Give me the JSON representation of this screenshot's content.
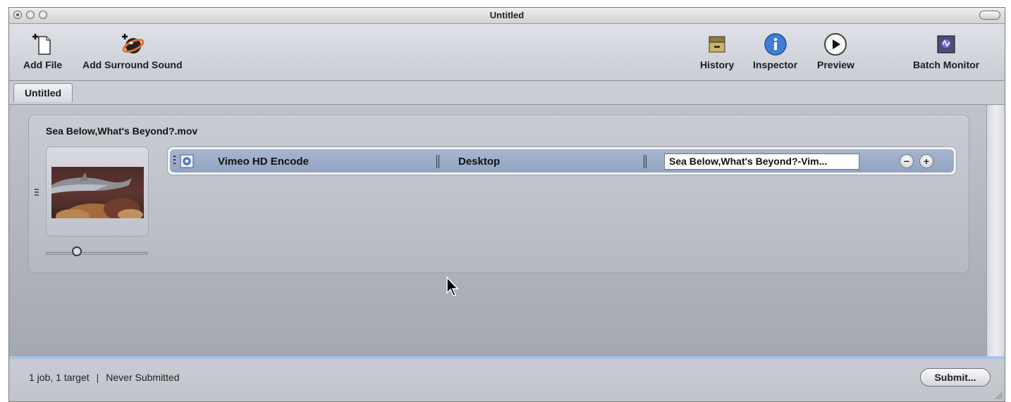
{
  "window": {
    "title": "Untitled"
  },
  "toolbar": {
    "add_file": "Add File",
    "add_surround_sound": "Add Surround Sound",
    "history": "History",
    "inspector": "Inspector",
    "preview": "Preview",
    "batch_monitor": "Batch Monitor"
  },
  "tabs": [
    {
      "label": "Untitled",
      "active": true
    }
  ],
  "job": {
    "source_file": "Sea Below,What's Beyond?.mov",
    "thumbnail_slider_fraction": 0.3,
    "targets": [
      {
        "setting": "Vimeo HD Encode",
        "destination": "Desktop",
        "output_filename": "Sea Below,What's Beyond?-Vim..."
      }
    ]
  },
  "status": {
    "summary": "1 job, 1 target",
    "separator": "|",
    "submission": "Never Submitted",
    "submit_label": "Submit..."
  },
  "colors": {
    "target_row": "#9dadca",
    "status_accent": "#a8c2e6"
  }
}
